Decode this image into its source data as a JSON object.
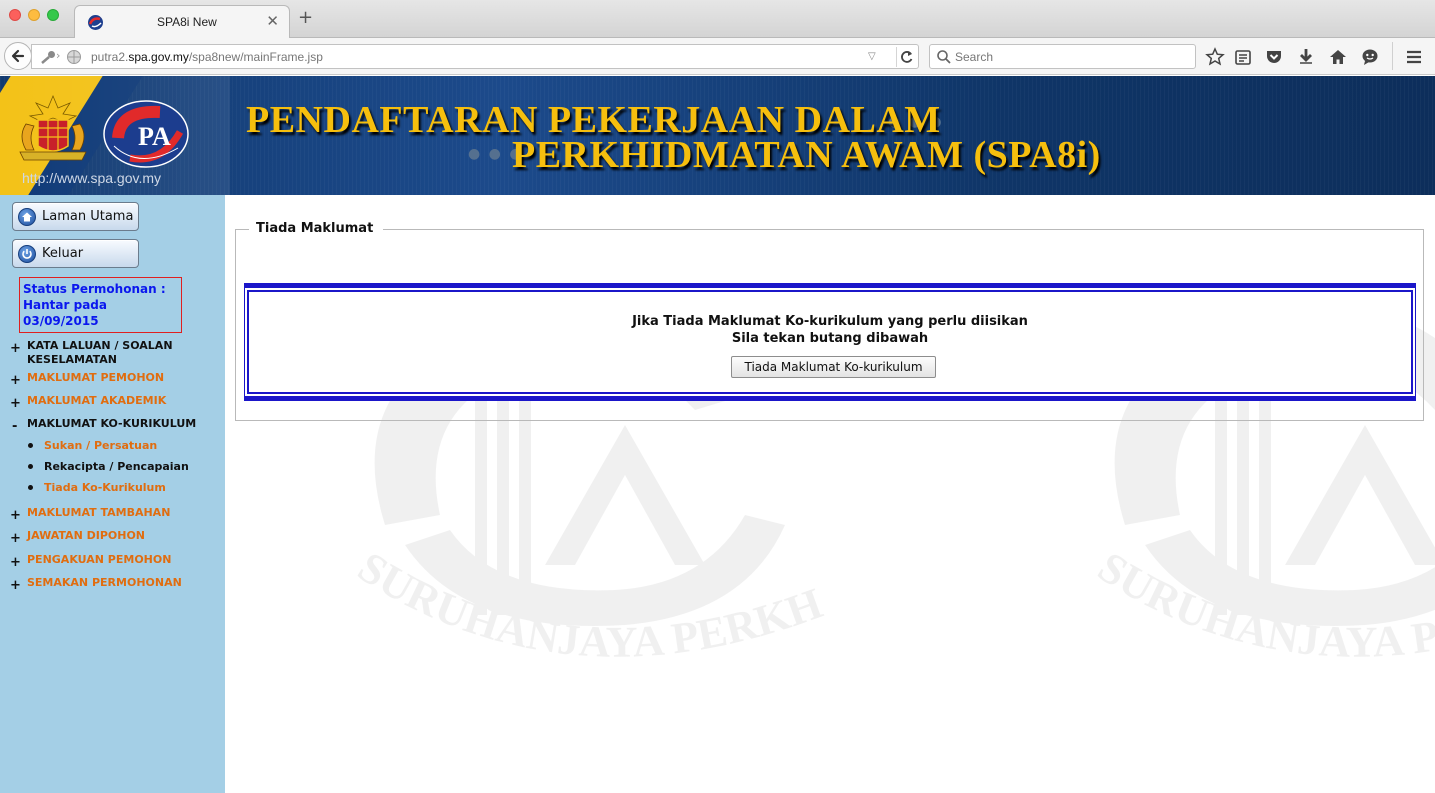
{
  "browser": {
    "tab_title": "SPA8i New",
    "tab_close": "✕",
    "new_tab": "+",
    "url_prefix": "putra2.",
    "url_domain": "spa.gov.my",
    "url_path": "/spa8new/mainFrame.jsp",
    "search_placeholder": "Search",
    "icons": [
      "back-icon",
      "key-icon",
      "globe-icon",
      "dropdown-icon",
      "reload-icon",
      "search-icon",
      "bookmark-star-icon",
      "reading-list-icon",
      "pocket-icon",
      "download-icon",
      "home-icon",
      "chat-icon",
      "menu-icon"
    ]
  },
  "banner": {
    "site_url": "http://www.spa.gov.my",
    "title_line1": "PENDAFTARAN PEKERJAAN DALAM",
    "title_line2": "PERKHIDMATAN AWAM (SPA8i)",
    "title_color": "#f6bf0e",
    "dots": "● ● ●"
  },
  "sidebar": {
    "home_button": "Laman Utama",
    "logout_button": "Keluar",
    "status_label": "Status Permohonan :",
    "status_value": "Hantar pada",
    "status_date": "03/09/2015",
    "menu": [
      {
        "sign": "+",
        "label_line1": "KATA LALUAN / SOALAN",
        "label_line2": "KESELAMATAN"
      },
      {
        "sign": "+",
        "label": "MAKLUMAT PEMOHON"
      },
      {
        "sign": "+",
        "label": "MAKLUMAT AKADEMIK"
      },
      {
        "sign": "-",
        "label": "MAKLUMAT KO-KURIKULUM"
      },
      {
        "sign": "+",
        "label": "MAKLUMAT TAMBAHAN"
      },
      {
        "sign": "+",
        "label": "JAWATAN DIPOHON"
      },
      {
        "sign": "+",
        "label": "PENGAKUAN PEMOHON"
      },
      {
        "sign": "+",
        "label": "SEMAKAN PERMOHONAN"
      }
    ],
    "submenu": [
      {
        "label": "Sukan / Persatuan"
      },
      {
        "label": "Rekacipta / Pencapaian"
      },
      {
        "label": "Tiada Ko-Kurikulum"
      }
    ],
    "colors": {
      "link": "#e06d10",
      "active": "#111111",
      "status": "#0a17ee",
      "background": "#a4cfe6"
    }
  },
  "main": {
    "legend": "Tiada Maklumat",
    "message_line1": "Jika Tiada Maklumat Ko-kurikulum yang perlu diisikan",
    "message_line2": "Sila tekan butang dibawah",
    "button_label": "Tiada Maklumat Ko-kurikulum",
    "watermark_text": "SURUHANJAYA PERKHIDMATAN AWAM",
    "watermark_text_clipped": "SURUHANJAYA PERKHIDM",
    "border_color": "#1b16c9"
  }
}
